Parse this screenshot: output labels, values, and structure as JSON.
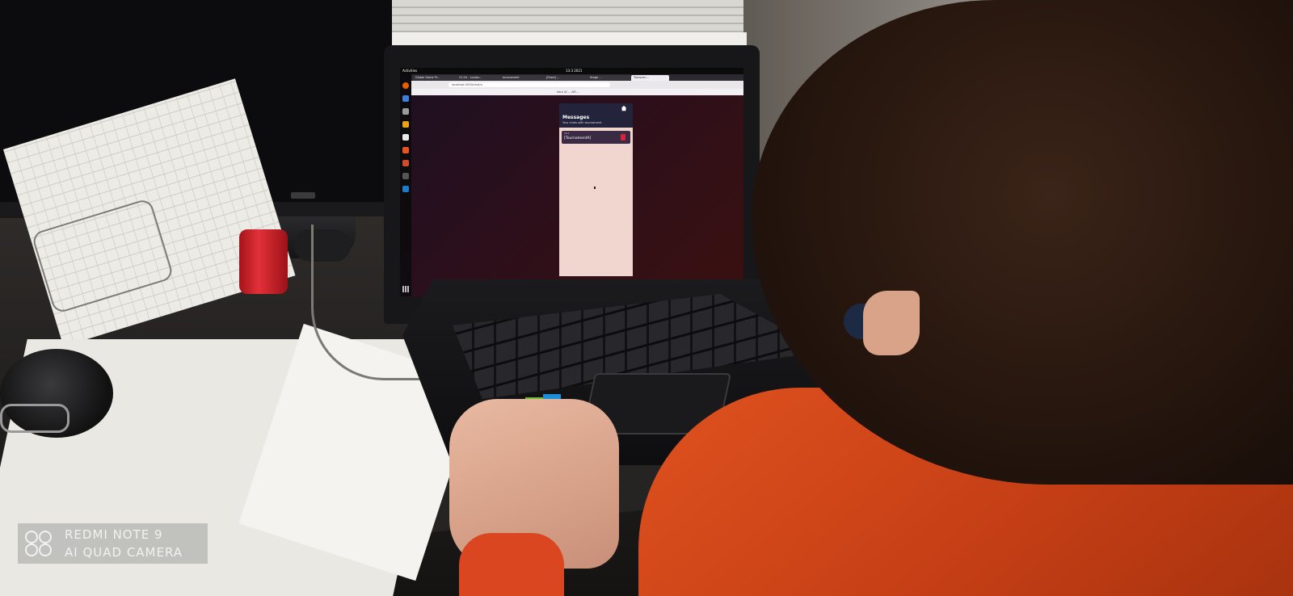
{
  "photo": {
    "watermark": {
      "line1": "REDMI NOTE 9",
      "line2": "AI QUAD CAMERA"
    }
  },
  "desktop": {
    "top_bar": {
      "activities_label": "Activities",
      "clock": "13:3 2021"
    },
    "browser": {
      "tabs": [
        {
          "label": "Firefox Web Browser"
        },
        {
          "label": "Global Game Pr..."
        },
        {
          "label": "21:24 - Loulou..."
        },
        {
          "label": "tournament"
        },
        {
          "label": "[Fixed] ..."
        },
        {
          "label": "Stage ..."
        },
        {
          "label": "Transcen..."
        }
      ],
      "url": "localhost:3000/chat/n",
      "bookmarks_label": "Intra 42 ... API ..."
    },
    "app": {
      "title": "Messages",
      "subtitle": "Your chats with tournament",
      "messages": [
        {
          "time": "19:2",
          "text": "[TournamentA]"
        }
      ]
    }
  }
}
